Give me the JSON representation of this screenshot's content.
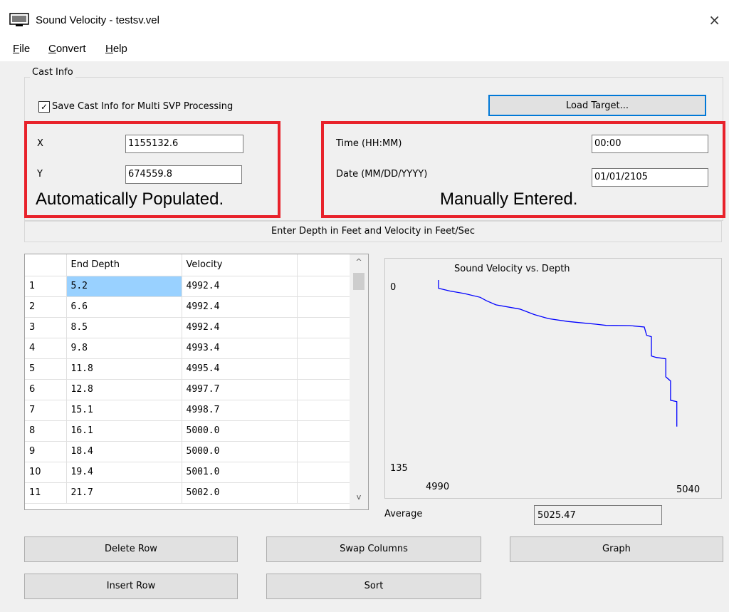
{
  "window": {
    "title": "Sound Velocity - testsv.vel",
    "icon": "monitor-icon",
    "close": "×"
  },
  "menu": [
    "File",
    "Convert",
    "Help"
  ],
  "cast_info": {
    "group_label": "Cast Info",
    "save_checkbox_label": "Save Cast Info for Multi SVP Processing",
    "save_checked": true,
    "check_mark": "✓",
    "load_target_label": "Load Target...",
    "x_label": "X",
    "x_value": "1155132.6",
    "y_label": "Y",
    "y_value": "674559.8",
    "time_label": "Time (HH:MM)",
    "time_value": "00:00",
    "date_label": "Date (MM/DD/YYYY)",
    "date_value": "01/01/2105"
  },
  "annotations": {
    "left": "Automatically Populated.",
    "right": "Manually Entered.",
    "color": "#e8222b"
  },
  "info_bar": "Enter Depth in Feet and Velocity in Feet/Sec",
  "table": {
    "headers": [
      "",
      "End Depth",
      "Velocity"
    ],
    "rows": [
      [
        "1",
        "5.2",
        "4992.4"
      ],
      [
        "2",
        "6.6",
        "4992.4"
      ],
      [
        "3",
        "8.5",
        "4992.4"
      ],
      [
        "4",
        "9.8",
        "4993.4"
      ],
      [
        "5",
        "11.8",
        "4995.4"
      ],
      [
        "6",
        "12.8",
        "4997.7"
      ],
      [
        "7",
        "15.1",
        "4998.7"
      ],
      [
        "8",
        "16.1",
        "5000.0"
      ],
      [
        "9",
        "18.4",
        "5000.0"
      ],
      [
        "10",
        "19.4",
        "5001.0"
      ],
      [
        "11",
        "21.7",
        "5002.0"
      ]
    ],
    "scroll_up": "^",
    "scroll_down": "v"
  },
  "chart_data": {
    "type": "line",
    "title": "Sound Velocity vs. Depth",
    "y_ticks": [
      "0",
      "135"
    ],
    "x_ticks": [
      "4990",
      "5040"
    ],
    "xlim": [
      4990,
      5040
    ],
    "ylim": [
      0,
      135
    ],
    "y_inverted": true,
    "series": [
      {
        "color": "#0000ff",
        "points": [
          [
            4990,
            0
          ],
          [
            4990,
            6
          ],
          [
            4992.4,
            8
          ],
          [
            4995.4,
            9.8
          ],
          [
            4998.7,
            12.5
          ],
          [
            5000,
            15
          ],
          [
            5002,
            18
          ],
          [
            5007,
            21
          ],
          [
            5010,
            25
          ],
          [
            5013,
            28
          ],
          [
            5017,
            30
          ],
          [
            5020,
            31
          ],
          [
            5023,
            32
          ],
          [
            5025,
            32.8
          ],
          [
            5030,
            33
          ],
          [
            5033,
            34
          ],
          [
            5033.5,
            40
          ],
          [
            5034.5,
            41
          ],
          [
            5034.5,
            55
          ],
          [
            5035.5,
            56
          ],
          [
            5037.5,
            57
          ],
          [
            5037.5,
            70
          ],
          [
            5038.5,
            73
          ],
          [
            5038.5,
            87
          ],
          [
            5039.8,
            88
          ],
          [
            5039.8,
            106
          ]
        ]
      }
    ]
  },
  "average": {
    "label": "Average",
    "value": "5025.47"
  },
  "buttons": {
    "delete_row": "Delete Row",
    "swap_columns": "Swap Columns",
    "graph": "Graph",
    "insert_row": "Insert Row",
    "sort": "Sort"
  }
}
